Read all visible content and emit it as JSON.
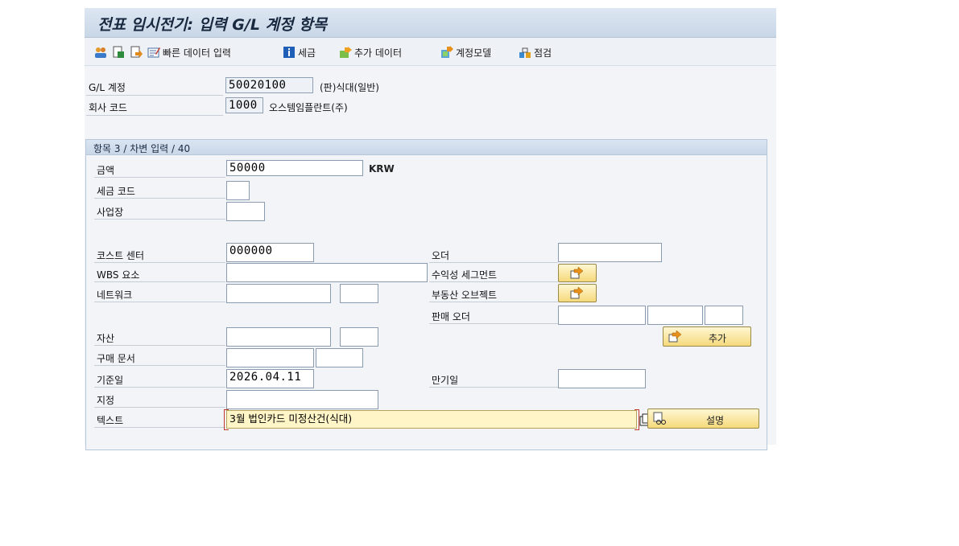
{
  "title": "전표 임시전기: 입력 G/L 계정 항목",
  "toolbar": {
    "items": [
      "빠른 데이터 입력",
      "세금",
      "추가 데이터",
      "계정모델",
      "점검"
    ]
  },
  "header": {
    "gl_account_label": "G/L 계정",
    "gl_account_value": "50020100",
    "gl_account_desc": "(판)식대(일반)",
    "company_code_label": "회사 코드",
    "company_code_value": "1000",
    "company_code_desc": "오스템임플란트(주)"
  },
  "group": {
    "title": "항목 3 / 차변 입력 / 40",
    "amount_label": "금액",
    "amount_value": "50000",
    "currency": "KRW",
    "tax_code_label": "세금 코드",
    "tax_code_value": "",
    "business_place_label": "사업장",
    "business_place_value": "",
    "cost_center_label": "코스트 센터",
    "cost_center_value": "000000",
    "wbs_label": "WBS 요소",
    "wbs_value": "",
    "network_label": "네트워크",
    "network_value": "",
    "asset_label": "자산",
    "asset_value": "",
    "purchase_doc_label": "구매 문서",
    "purchase_doc_value": "",
    "baseline_date_label": "기준일",
    "baseline_date_value": "2026.04.11",
    "assignment_label": "지정",
    "assignment_value": "",
    "text_label": "텍스트",
    "text_value": "3월 법인카드 미정산건(식대)",
    "order_label": "오더",
    "order_value": "",
    "profit_segment_label": "수익성 세그먼트",
    "real_estate_label": "부동산 오브젝트",
    "sales_order_label": "판매 오더",
    "due_date_label": "만기일",
    "due_date_value": "",
    "more_button": "추가",
    "long_text_button": "설명"
  },
  "colors": {
    "title_bg": "#c8d6e6",
    "button_yellow": "#f5d97b",
    "text_field_bg": "#fff5c7"
  }
}
